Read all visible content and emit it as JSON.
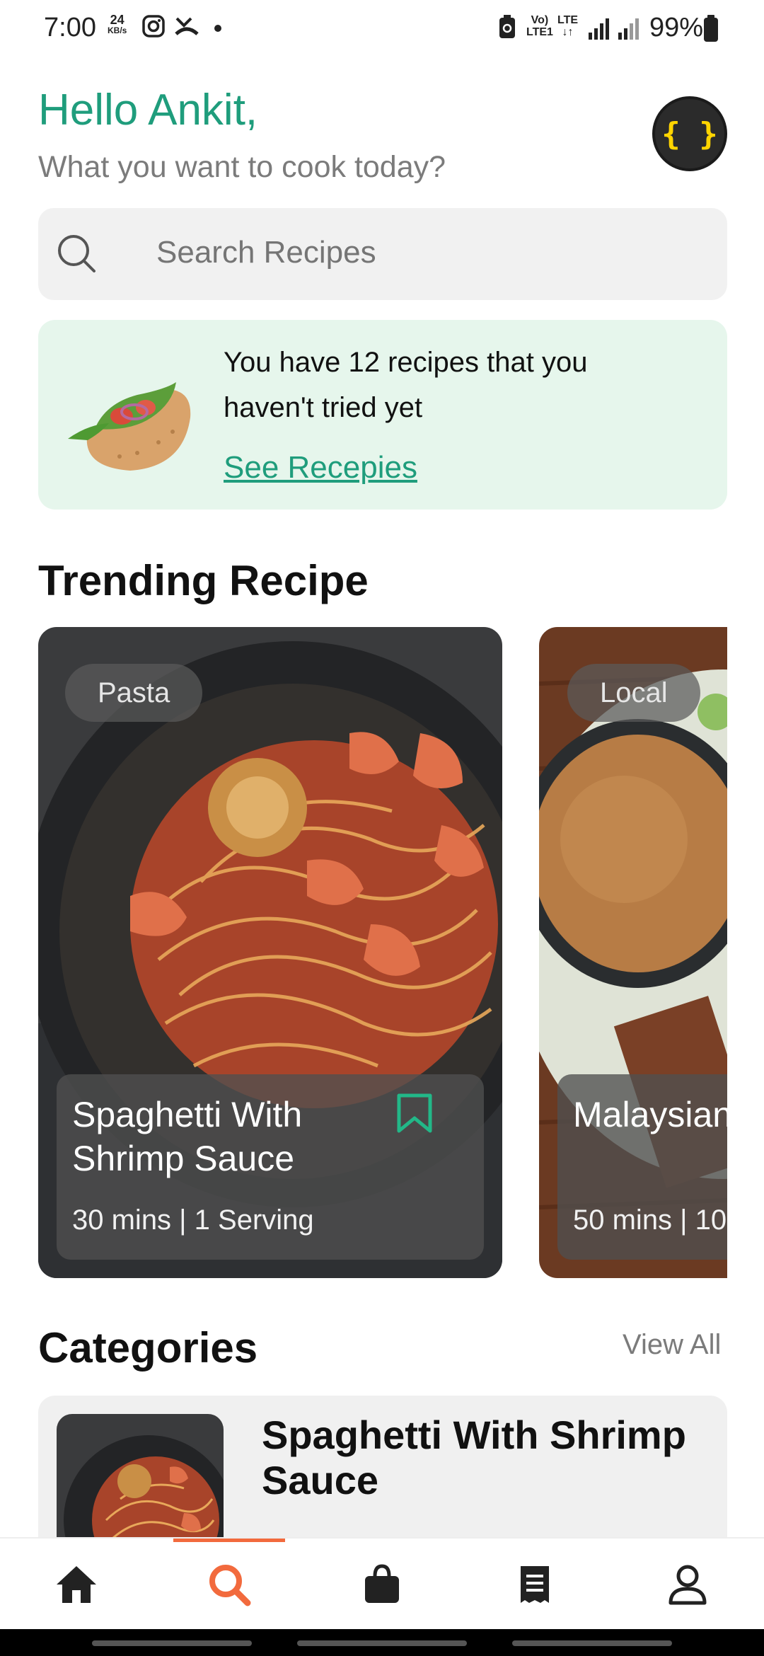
{
  "status_bar": {
    "time": "7:00",
    "net_speed_value": "24",
    "net_speed_unit": "KB/s",
    "volte": "Vo)",
    "lte1": "LTE1",
    "lte": "LTE",
    "battery": "99%"
  },
  "header": {
    "greeting": "Hello Ankit,",
    "subtitle": "What you want to cook today?",
    "avatar_glyph": "{ }"
  },
  "search": {
    "placeholder": "Search Recipes"
  },
  "banner": {
    "text": "You have 12 recipes that you haven't tried yet",
    "link": "See Recepies"
  },
  "trending": {
    "title": "Trending Recipe",
    "cards": [
      {
        "tag": "Pasta",
        "title": "Spaghetti With Shrimp Sauce",
        "meta": "30 mins | 1 Serving"
      },
      {
        "tag": "Local",
        "title": "Malaysian Chicken S",
        "meta": "50 mins | 10"
      }
    ]
  },
  "categories": {
    "title": "Categories",
    "view_all": "View All",
    "items": [
      {
        "title": "Spaghetti With Shrimp Sauce"
      }
    ]
  },
  "bottom_nav": {
    "items": [
      "home-icon",
      "search-icon",
      "shopping-bag-icon",
      "receipt-icon",
      "profile-icon"
    ],
    "active_index": 1
  },
  "colors": {
    "accent_green": "#1f9d7c",
    "accent_orange": "#f26a3d",
    "banner_bg": "#e6f6ec"
  }
}
